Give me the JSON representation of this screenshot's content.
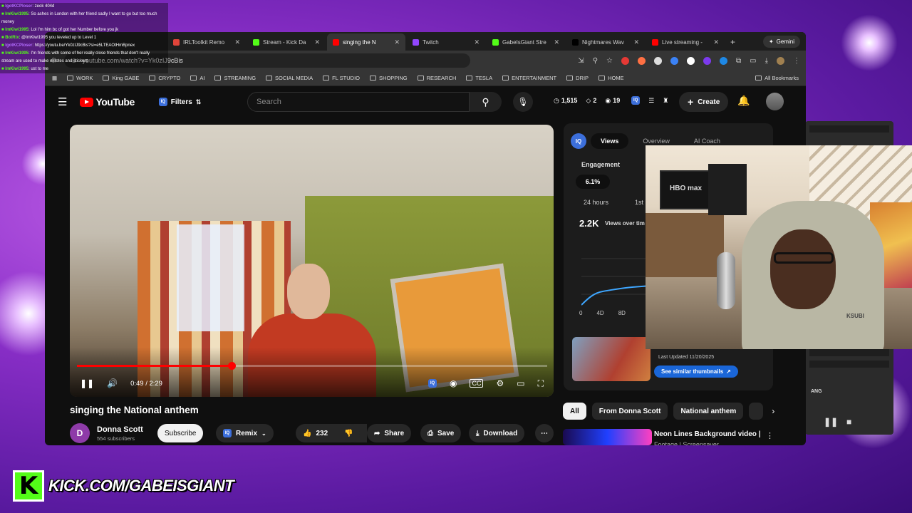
{
  "chat": [
    {
      "user": "IgotKCPloser",
      "msg": ": zeok 404d",
      "color": "#b36bff"
    },
    {
      "user": "ImKiwi1995",
      "msg": ": So ashes in London with her friend sadly I want to go but too much",
      "color": "#53fc18"
    },
    {
      "user": "",
      "msg": "money",
      "color": "#ffffff"
    },
    {
      "user": "ImKiwi1995",
      "msg": ": Lol I'm him bc of got her Number before you jk",
      "color": "#53fc18"
    },
    {
      "user": "BotRix",
      "msg": ": @ImKiwi1995 you leveled up to Level 1",
      "color": "#53fc18"
    },
    {
      "user": "IgotKCPloser",
      "msg": ": https://youtu.be/Yk0zIJ9cBis?si=e5LTEAOtHmBpnex",
      "color": "#b36bff"
    },
    {
      "user": "ImKiwi1995",
      "msg": ": I'm friends with some of her really close friends that don't really",
      "color": "#53fc18"
    },
    {
      "user": "",
      "msg": "stream are used to make emotes and stickers",
      "color": "#ffffff"
    },
    {
      "user": "ImKiwi1995",
      "msg": ": ust to me",
      "color": "#53fc18"
    }
  ],
  "browser": {
    "tabs": [
      {
        "title": "IRLToolkit Remo",
        "color": "#e0443a",
        "active": false
      },
      {
        "title": "Stream - Kick Da",
        "color": "#53fc18",
        "active": false
      },
      {
        "title": "singing the N",
        "color": "#ff0000",
        "active": true
      },
      {
        "title": "Twitch",
        "color": "#9146ff",
        "active": false
      },
      {
        "title": "GabeIsGiant Stre",
        "color": "#53fc18",
        "active": false
      },
      {
        "title": "Nightmares Wav",
        "color": "#000000",
        "active": false
      },
      {
        "title": "Live streaming -",
        "color": "#ff0000",
        "active": false
      }
    ],
    "gemini_label": "Gemini",
    "url": "youtube.com/watch?v=Yk0zIJ9cBis",
    "bookmarks": [
      "WORK",
      "King GABE",
      "CRYPTO",
      "AI",
      "STREAMING",
      "SOCIAL MEDIA",
      "FL STUDIO",
      "SHOPPING",
      "RESEARCH",
      "TESLA",
      "ENTERTAINMENT",
      "DRIP",
      "HOME"
    ],
    "all_bookmarks": "All Bookmarks"
  },
  "youtube": {
    "logo": "YouTube",
    "filters": "Filters",
    "search_placeholder": "Search",
    "stats": {
      "viewers": "1,515",
      "a": "2",
      "b": "19"
    },
    "create": "Create",
    "player": {
      "time": "0:49 / 2:29",
      "progress_fraction": 0.33
    },
    "video_title": "singing the National anthem",
    "channel": {
      "initial": "D",
      "name": "Donna Scott",
      "subs": "554 subscribers"
    },
    "buttons": {
      "subscribe": "Subscribe",
      "remix": "Remix",
      "likes": "232",
      "share": "Share",
      "save": "Save",
      "download": "Download"
    }
  },
  "iq_panel": {
    "tabs": [
      "Views",
      "Overview",
      "AI Coach"
    ],
    "engagement_label": "Engagement",
    "engagement_value": "6.1%",
    "range_a": "24 hours",
    "range_b": "1st 7",
    "views_value": "2.2K",
    "views_label": "Views over tim",
    "axis": [
      "0",
      "4D",
      "8D"
    ],
    "last_updated": "Last Updated 11/20/2025",
    "similar": "See similar thumbnails"
  },
  "chips": [
    "All",
    "From Donna Scott",
    "National anthem"
  ],
  "recommended": {
    "title": "Neon Lines Background video |",
    "sub": "Footage | Screensaver"
  },
  "webcam": {
    "tv_text": "HBO max",
    "hoodie": "KSUBI"
  },
  "obs": {
    "label": "ANG"
  },
  "kick": {
    "logo": "K",
    "url": "KICK.COM/GABEISGIANT"
  }
}
